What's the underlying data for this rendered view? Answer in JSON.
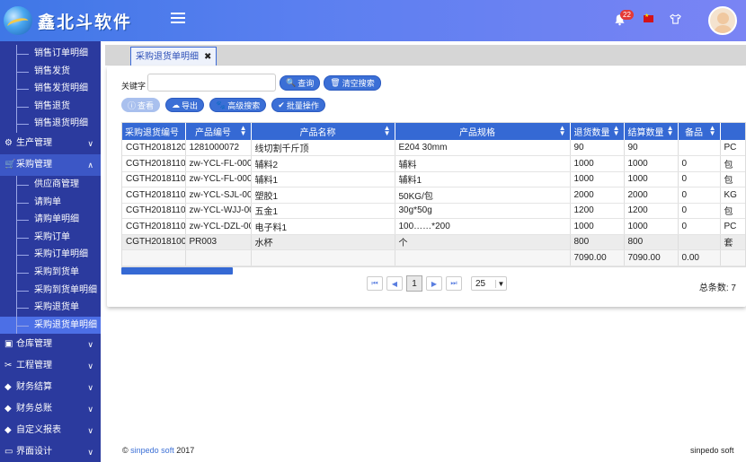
{
  "header": {
    "logo_text": "鑫北斗软件",
    "notification_count": "22"
  },
  "sidebar": {
    "top_items": [
      "销售订单明细",
      "销售发货",
      "销售发货明细",
      "销售退货",
      "销售退货明细"
    ],
    "groups": [
      {
        "label": "生产管理"
      },
      {
        "label": "采购管理"
      },
      {
        "label": "仓库管理"
      },
      {
        "label": "工程管理"
      },
      {
        "label": "财务结算"
      },
      {
        "label": "财务总账"
      },
      {
        "label": "自定义报表"
      },
      {
        "label": "界面设计"
      }
    ],
    "purchase_items": [
      "供应商管理",
      "请购单",
      "请购单明细",
      "采购订单",
      "采购订单明细",
      "采购到货单",
      "采购到货单明细",
      "采购退货单",
      "采购退货单明细"
    ]
  },
  "tab": {
    "label": "采购退货单明细"
  },
  "search": {
    "label": "关键字",
    "value": "",
    "query_btn": "查询",
    "clear_btn": "清空搜索"
  },
  "actions": {
    "view": "查看",
    "export": "导出",
    "advanced": "高级搜索",
    "batch": "批量操作"
  },
  "table": {
    "headers": [
      "采购退货编号",
      "产品编号",
      "产品名称",
      "产品规格",
      "退货数量",
      "结算数量",
      "备品",
      "单位"
    ],
    "rows": [
      [
        "CGTH2018120",
        "1281000072",
        "线切割千斤顶",
        "E204 30mm",
        "90",
        "90",
        "",
        "PC"
      ],
      [
        "CGTH2018110",
        "zw-YCL-FL-000",
        "辅料2",
        "辅料",
        "1000",
        "1000",
        "0",
        "包"
      ],
      [
        "CGTH2018110",
        "zw-YCL-FL-000",
        "辅料1",
        "辅料1",
        "1000",
        "1000",
        "0",
        "包"
      ],
      [
        "CGTH2018110",
        "zw-YCL-SJL-00",
        "塑胶1",
        "50KG/包",
        "2000",
        "2000",
        "0",
        "KG"
      ],
      [
        "CGTH2018110",
        "zw-YCL-WJJ-00",
        "五金1",
        "30g*50g",
        "1200",
        "1200",
        "0",
        "包"
      ],
      [
        "CGTH2018110",
        "zw-YCL-DZL-00",
        "电子料1",
        "100……*200",
        "1000",
        "1000",
        "0",
        "PC"
      ],
      [
        "CGTH2018100",
        "PR003",
        "水杯",
        "个",
        "800",
        "800",
        "",
        "套"
      ]
    ],
    "totals": [
      "",
      "",
      "",
      "",
      "7090.00",
      "7090.00",
      "0.00",
      ""
    ]
  },
  "pager": {
    "current_page": "1",
    "page_size": "25",
    "total_label": "总条数: 7"
  },
  "footer": {
    "copyright": "©",
    "brand_link": "sinpedo soft",
    "year": "2017",
    "right_text": "sinpedo soft"
  }
}
